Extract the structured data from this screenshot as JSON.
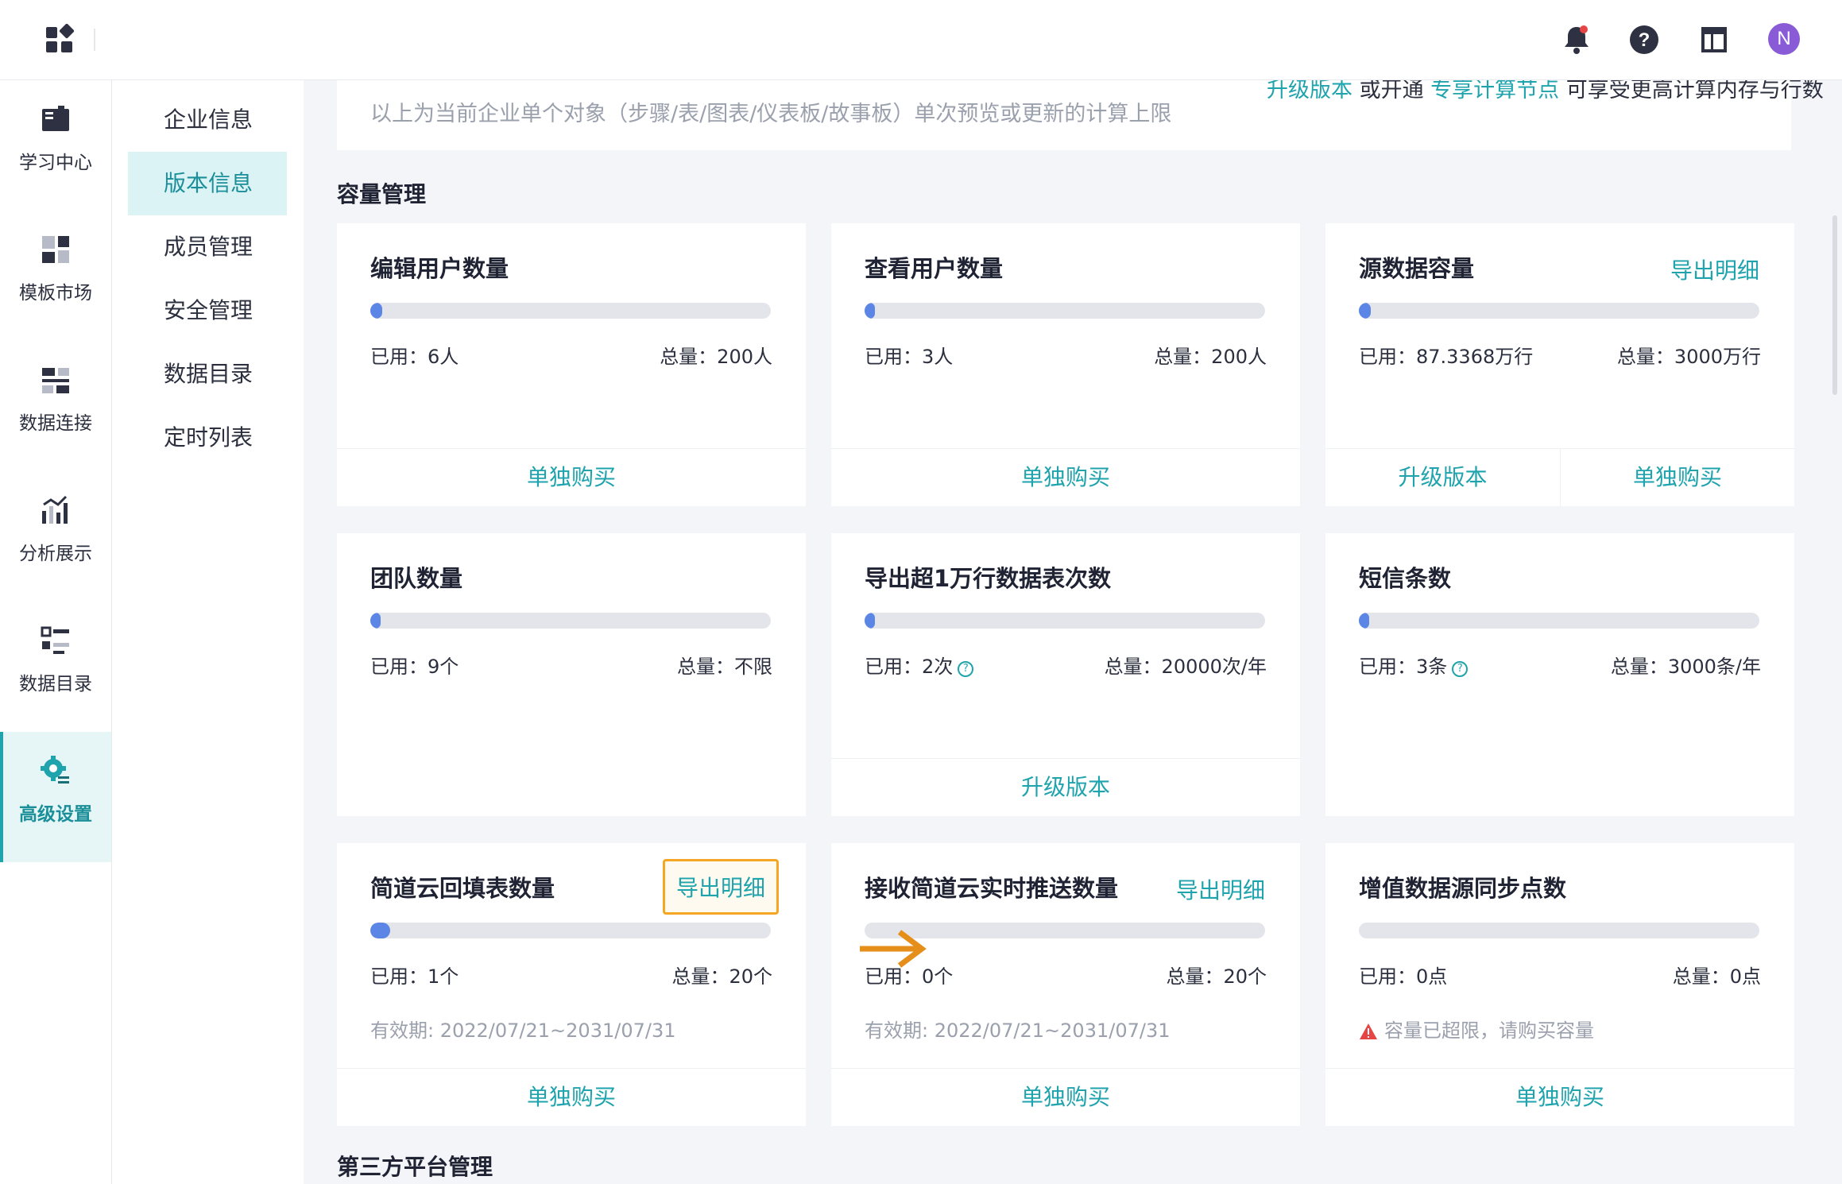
{
  "topbar": {
    "icons": [
      "apps-icon",
      "bell-icon",
      "help-icon",
      "layout-icon"
    ],
    "avatar_letter": "N"
  },
  "rail": {
    "items": [
      {
        "label": "学习中心",
        "icon": "book-icon"
      },
      {
        "label": "模板市场",
        "icon": "template-icon"
      },
      {
        "label": "数据连接",
        "icon": "connection-icon"
      },
      {
        "label": "分析展示",
        "icon": "chart-icon"
      },
      {
        "label": "数据目录",
        "icon": "catalog-icon"
      },
      {
        "label": "高级设置",
        "icon": "settings-icon",
        "active": true
      }
    ]
  },
  "subnav": {
    "items": [
      {
        "label": "企业信息"
      },
      {
        "label": "版本信息",
        "active": true
      },
      {
        "label": "成员管理"
      },
      {
        "label": "安全管理"
      },
      {
        "label": "数据目录"
      },
      {
        "label": "定时列表"
      }
    ]
  },
  "top_note": {
    "text": "以上为当前企业单个对象（步骤/表/图表/仪表板/故事板）单次预览或更新的计算上限",
    "upsell_link1": "升级版本",
    "upsell_mid": " 或开通 ",
    "upsell_link2": "专享计算节点",
    "upsell_tail": " 可享受更高计算内存与行数"
  },
  "sections": {
    "capacity": "容量管理",
    "third_party": "第三方平台管理"
  },
  "cards": [
    {
      "title": "编辑用户数量",
      "used": "已用：6人",
      "total": "总量：200人",
      "progress": 0.03,
      "footer": [
        "单独购买"
      ]
    },
    {
      "title": "查看用户数量",
      "used": "已用：3人",
      "total": "总量：200人",
      "progress": 0.015,
      "footer": [
        "单独购买"
      ]
    },
    {
      "title": "源数据容量",
      "export": "导出明细",
      "used": "已用：87.3368万行",
      "total": "总量：3000万行",
      "progress": 0.029,
      "footer": [
        "升级版本",
        "单独购买"
      ]
    },
    {
      "title": "团队数量",
      "used": "已用：9个",
      "total": "总量：不限",
      "progress": 0.005,
      "footer": []
    },
    {
      "title": "导出超1万行数据表次数",
      "used": "已用：2次",
      "help": true,
      "total": "总量：20000次/年",
      "progress": 0.0001,
      "footer": [
        "升级版本"
      ]
    },
    {
      "title": "短信条数",
      "used": "已用：3条",
      "help": true,
      "total": "总量：3000条/年",
      "progress": 0.001,
      "footer": []
    },
    {
      "title": "简道云回填表数量",
      "export": "导出明细",
      "export_highlight": true,
      "used": "已用：1个",
      "total": "总量：20个",
      "progress": 0.05,
      "validity": "有效期: 2022/07/21~2031/07/31",
      "footer": [
        "单独购买"
      ]
    },
    {
      "title": "接收简道云实时推送数量",
      "export": "导出明细",
      "used": "已用：0个",
      "total": "总量：20个",
      "progress": 0,
      "validity": "有效期: 2022/07/21~2031/07/31",
      "footer": [
        "单独购买"
      ]
    },
    {
      "title": "增值数据源同步点数",
      "used": "已用：0点",
      "total": "总量：0点",
      "progress": 0,
      "warning": "容量已超限，请购买容量",
      "footer": [
        "单独购买"
      ]
    }
  ],
  "colors": {
    "accent": "#1fa3ad",
    "bar_fill": "#5b86e5",
    "highlight": "#f5a623",
    "warning": "#e54545"
  }
}
